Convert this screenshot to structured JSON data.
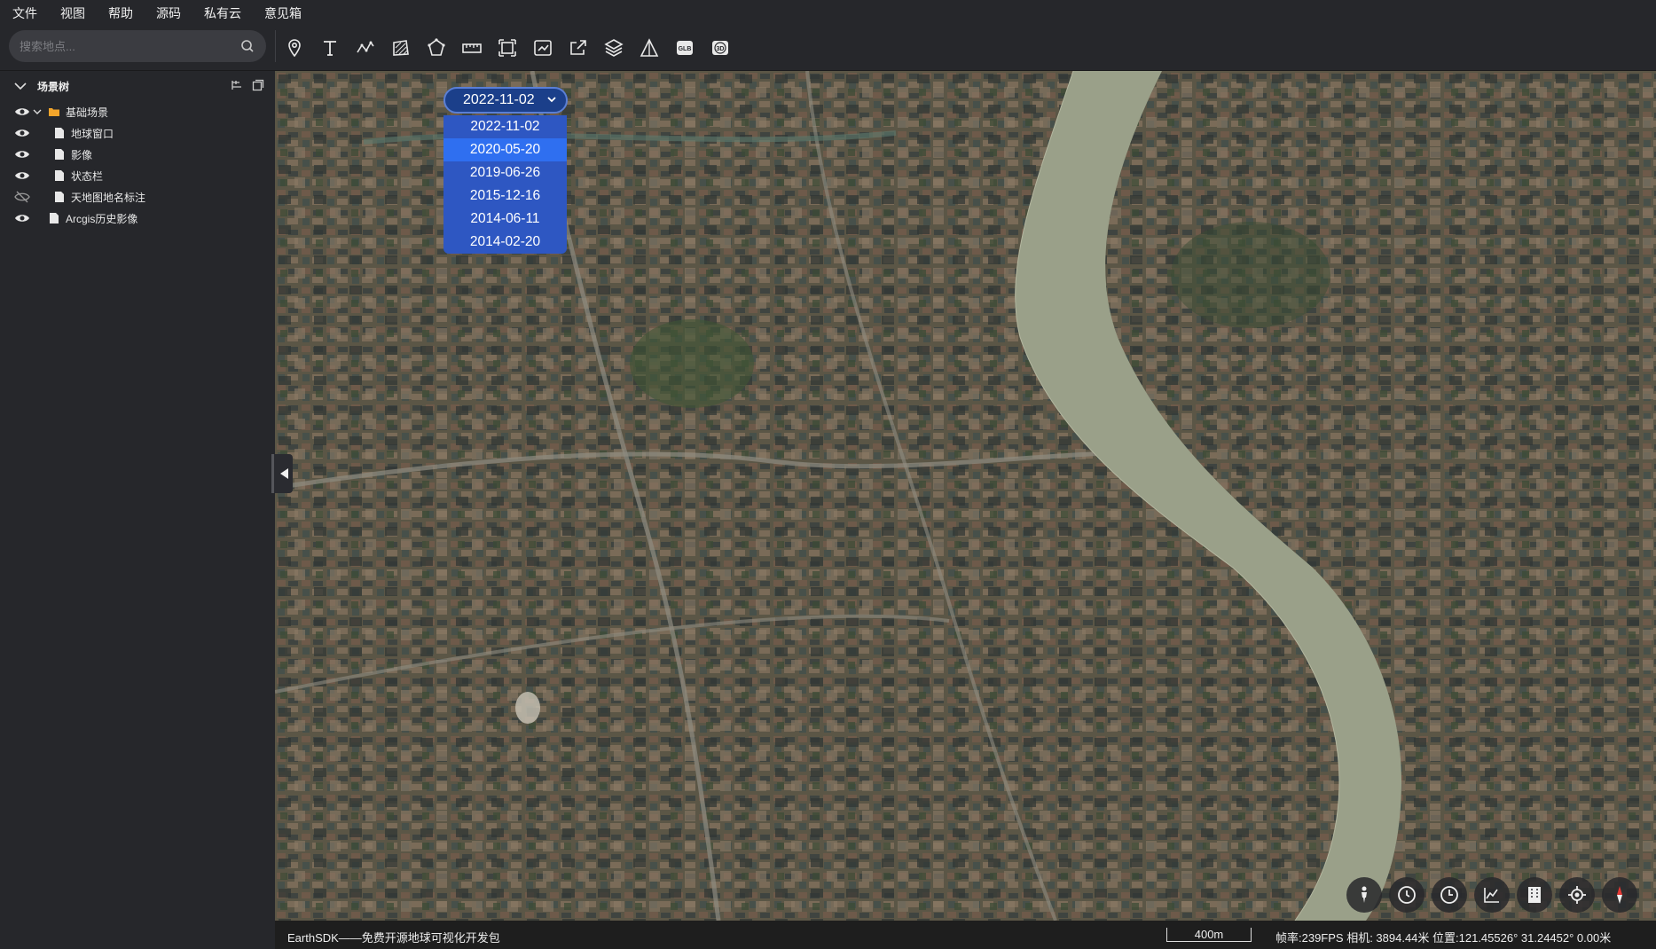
{
  "menu": [
    "文件",
    "视图",
    "帮助",
    "源码",
    "私有云",
    "意见箱"
  ],
  "search": {
    "placeholder": "搜索地点..."
  },
  "toolbar": {
    "tools": [
      "pin-icon",
      "text-icon",
      "polyline-icon",
      "polygon-hatch-icon",
      "polygon-icon",
      "measure-icon",
      "frame-icon",
      "image-export-icon",
      "share-icon",
      "layers-icon",
      "terrain-icon",
      "glb-icon",
      "3d-icon"
    ],
    "glb_label": "GLB",
    "threed_label": "3D"
  },
  "scene_tree": {
    "title": "场景树",
    "items": [
      {
        "label": "基础场景",
        "type": "folder",
        "visible": true,
        "expanded": true
      },
      {
        "label": "地球窗口",
        "type": "file",
        "visible": true
      },
      {
        "label": "影像",
        "type": "file",
        "visible": true
      },
      {
        "label": "状态栏",
        "type": "file",
        "visible": true
      },
      {
        "label": "天地图地名标注",
        "type": "file",
        "visible": false
      },
      {
        "label": "Arcgis历史影像",
        "type": "file",
        "visible": true
      }
    ]
  },
  "date_selector": {
    "value": "2022-11-02",
    "options": [
      "2022-11-02",
      "2020-05-20",
      "2019-06-26",
      "2015-12-16",
      "2014-06-11",
      "2014-02-20"
    ],
    "highlighted": "2020-05-20"
  },
  "status": {
    "brand": "EarthSDK——免费开源地球可视化开发包",
    "scale": "400m",
    "readout": "帧率:239FPS 相机: 3894.44米 位置:121.45526° 31.24452° 0.00米"
  },
  "map_controls": [
    "person-icon",
    "clock-icon",
    "time-icon",
    "profile-icon",
    "building-icon",
    "locate-icon",
    "compass-icon"
  ],
  "colors": {
    "accent": "#2f6ff0",
    "panel": "#26272b",
    "river": "#9aa089"
  }
}
